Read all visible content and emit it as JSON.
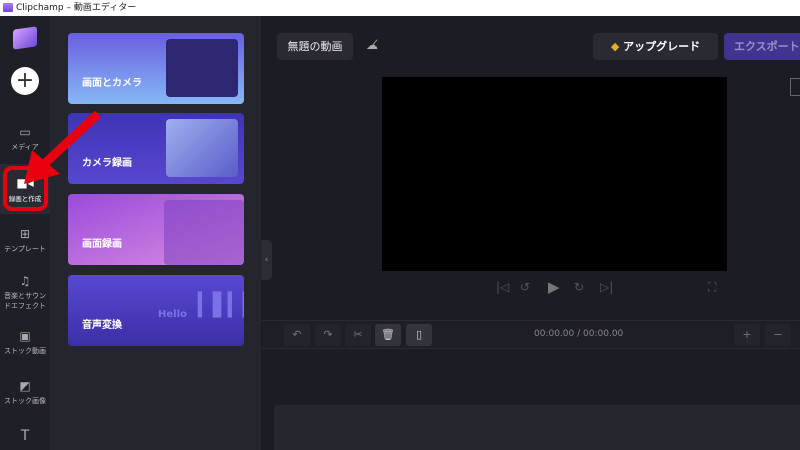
{
  "window": {
    "title": "Clipchamp – 動画エディター"
  },
  "sidebar": {
    "items": [
      {
        "label": "メディア",
        "icon": "folder-icon"
      },
      {
        "label": "録画と作成",
        "icon": "video-camera-icon",
        "active": true
      },
      {
        "label": "テンプレート",
        "icon": "templates-icon"
      },
      {
        "label": "音楽とサウンドエフェクト",
        "icon": "music-icon"
      },
      {
        "label": "ストック動画",
        "icon": "film-icon"
      },
      {
        "label": "ストック画像",
        "icon": "image-icon"
      },
      {
        "label": "",
        "icon": "text-icon"
      }
    ]
  },
  "panel": {
    "cards": [
      {
        "label": "画面とカメラ"
      },
      {
        "label": "カメラ録画"
      },
      {
        "label": "画面録画"
      },
      {
        "label": "音声変換",
        "decor": "Hello"
      }
    ]
  },
  "header": {
    "project_title": "無題の動画",
    "upgrade_label": "アップグレード",
    "export_label": "エクスポート"
  },
  "timeline": {
    "current_time": "00:00.00",
    "total_time": "00:00.00"
  },
  "colors": {
    "accent": "#3f3591",
    "highlight": "#e80010"
  }
}
